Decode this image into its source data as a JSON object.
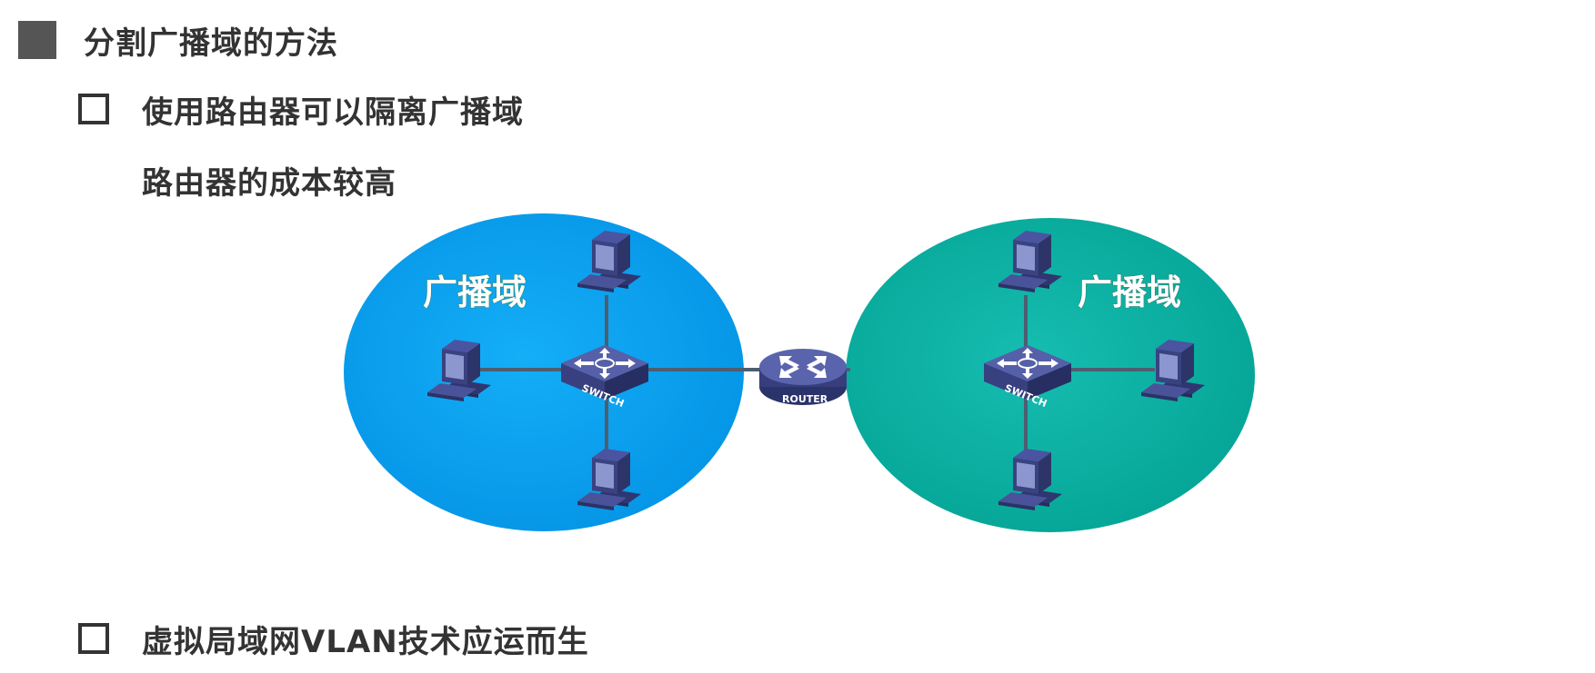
{
  "heading": "分割广播域的方法",
  "bullets": [
    {
      "text": "使用路由器可以隔离广播域"
    },
    {
      "text": "虚拟局域网VLAN技术应运而生"
    }
  ],
  "sub_text": "路由器的成本较高",
  "diagram": {
    "left_domain_label": "广播域",
    "right_domain_label": "广播域",
    "router_label": "ROUTER",
    "switch_label": "SWITCH",
    "colors": {
      "left_domain": "#0aa1f0",
      "right_domain": "#0fb3a7",
      "device": "#4a5599",
      "link": "#4d5e70"
    }
  }
}
